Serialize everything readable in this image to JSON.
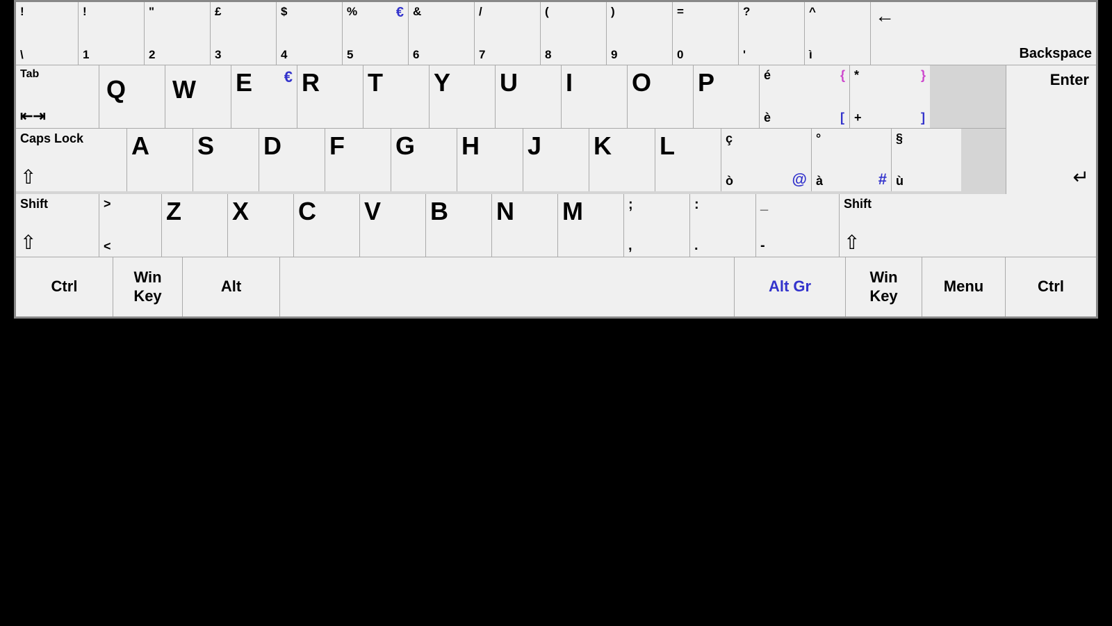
{
  "keyboard": {
    "rows": {
      "row1": [
        {
          "top": "!",
          "bottom": "\\",
          "id": "key-backtick"
        },
        {
          "top": "!",
          "bottom": "1",
          "id": "key-1"
        },
        {
          "top": "\"",
          "bottom": "2",
          "id": "key-2"
        },
        {
          "top": "£",
          "bottom": "3",
          "id": "key-3"
        },
        {
          "top": "$",
          "bottom": "4",
          "id": "key-4"
        },
        {
          "top": "%",
          "bottom": "5",
          "euro": "€",
          "id": "key-5"
        },
        {
          "top": "&",
          "bottom": "6",
          "id": "key-6"
        },
        {
          "top": "/",
          "bottom": "7",
          "id": "key-7"
        },
        {
          "top": "(",
          "bottom": "8",
          "id": "key-8"
        },
        {
          "top": ")",
          "bottom": "9",
          "id": "key-9"
        },
        {
          "top": "=",
          "bottom": "0",
          "id": "key-0"
        },
        {
          "top": "?",
          "bottom": "'",
          "id": "key-question"
        },
        {
          "top": "^",
          "bottom": "ì",
          "id": "key-caret"
        },
        {
          "label": "Backspace",
          "arrow": "←",
          "id": "key-backspace"
        }
      ],
      "row2": [
        {
          "label": "Tab",
          "id": "key-tab"
        },
        {
          "letter": "Q",
          "id": "key-q"
        },
        {
          "letter": "W",
          "id": "key-w"
        },
        {
          "letter": "E",
          "euro": "€",
          "id": "key-e"
        },
        {
          "letter": "R",
          "id": "key-r"
        },
        {
          "letter": "T",
          "id": "key-t"
        },
        {
          "letter": "Y",
          "id": "key-y"
        },
        {
          "letter": "U",
          "id": "key-u"
        },
        {
          "letter": "I",
          "id": "key-i"
        },
        {
          "letter": "O",
          "id": "key-o"
        },
        {
          "letter": "P",
          "id": "key-p"
        },
        {
          "top": "é",
          "bottom": "è",
          "top2": "{",
          "bottom2": "[",
          "id": "key-bracket-open"
        },
        {
          "top": "*",
          "bottom": "+",
          "top2": "}",
          "bottom2": "]",
          "id": "key-bracket-close"
        }
      ],
      "row3": [
        {
          "label": "Caps Lock",
          "arrow": "⇧",
          "id": "key-capslock"
        },
        {
          "letter": "A",
          "id": "key-a"
        },
        {
          "letter": "S",
          "id": "key-s"
        },
        {
          "letter": "D",
          "id": "key-d"
        },
        {
          "letter": "F",
          "id": "key-f"
        },
        {
          "letter": "G",
          "id": "key-g"
        },
        {
          "letter": "H",
          "id": "key-h"
        },
        {
          "letter": "J",
          "id": "key-j"
        },
        {
          "letter": "K",
          "id": "key-k"
        },
        {
          "letter": "L",
          "id": "key-l"
        },
        {
          "top": "ç",
          "bottom": "ò",
          "top2": "@",
          "id": "key-semicolon"
        },
        {
          "top": "°",
          "bottom": "à",
          "top2": "#",
          "id": "key-apostrophe"
        },
        {
          "top": "§",
          "bottom": "ù",
          "id": "key-hash"
        }
      ],
      "row4": [
        {
          "label": "Shift",
          "arrow": "⇧",
          "id": "key-shift-left"
        },
        {
          "top": ">",
          "bottom": "<",
          "id": "key-lessthan"
        },
        {
          "letter": "Z",
          "id": "key-z"
        },
        {
          "letter": "X",
          "id": "key-x"
        },
        {
          "letter": "C",
          "id": "key-c"
        },
        {
          "letter": "V",
          "id": "key-v"
        },
        {
          "letter": "B",
          "id": "key-b"
        },
        {
          "letter": "N",
          "id": "key-n"
        },
        {
          "letter": "M",
          "id": "key-m"
        },
        {
          "top": ";",
          "bottom": ",",
          "id": "key-comma"
        },
        {
          "top": ":",
          "bottom": ".",
          "id": "key-period"
        },
        {
          "top": "_",
          "bottom": "-",
          "id": "key-slash"
        },
        {
          "label": "Shift",
          "arrow": "⇧",
          "id": "key-shift-right"
        }
      ],
      "row5": [
        {
          "label": "Ctrl",
          "id": "key-ctrl-left"
        },
        {
          "label": "Win\nKey",
          "id": "key-win-left"
        },
        {
          "label": "Alt",
          "id": "key-alt"
        },
        {
          "label": "",
          "id": "key-space"
        },
        {
          "label": "Alt Gr",
          "id": "key-altgr",
          "blue": true
        },
        {
          "label": "Win\nKey",
          "id": "key-win-right"
        },
        {
          "label": "Menu",
          "id": "key-menu"
        },
        {
          "label": "Ctrl",
          "id": "key-ctrl-right"
        }
      ]
    }
  }
}
